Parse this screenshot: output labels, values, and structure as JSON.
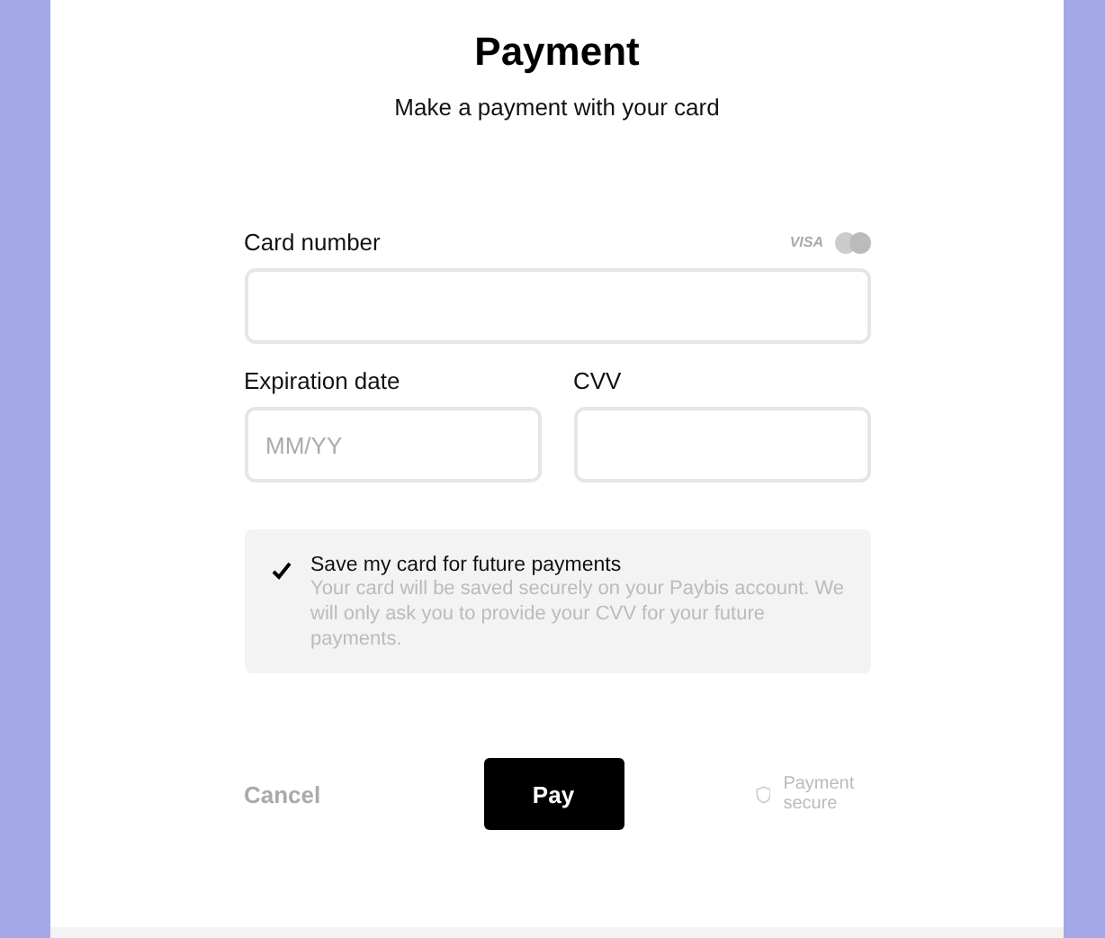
{
  "title": "Payment",
  "subtitle": "Make a payment with your card",
  "card_number": {
    "label": "Card number",
    "brand": "VISA"
  },
  "expiration": {
    "label": "Expiration date",
    "placeholder": "MM/YY"
  },
  "cvv": {
    "label": "CVV"
  },
  "save_card": {
    "checked": true,
    "label": "Save my card for future payments",
    "note": "Your card will be saved securely on your Paybis account. We will only ask you to provide your CVV for your future payments."
  },
  "actions": {
    "cancel": "Cancel",
    "pay": "Pay",
    "secure": "Payment secure"
  }
}
